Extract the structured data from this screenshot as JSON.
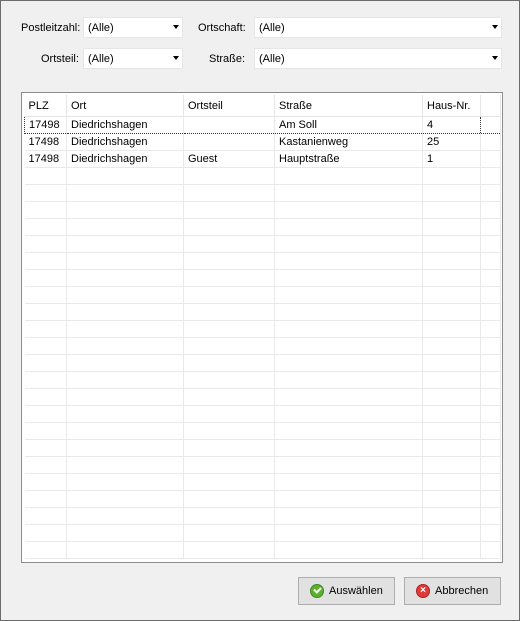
{
  "filters": {
    "plz_label": "Postleitzahl:",
    "plz_value": "(Alle)",
    "ortschaft_label": "Ortschaft:",
    "ortschaft_value": "(Alle)",
    "ortsteil_label": "Ortsteil:",
    "ortsteil_value": "(Alle)",
    "strasse_label": "Straße:",
    "strasse_value": "(Alle)"
  },
  "table": {
    "headers": [
      "PLZ",
      "Ort",
      "Ortsteil",
      "Straße",
      "Haus-Nr."
    ],
    "rows": [
      [
        "17498",
        "Diedrichshagen",
        "",
        "Am Soll",
        "4"
      ],
      [
        "17498",
        "Diedrichshagen",
        "",
        "Kastanienweg",
        "25"
      ],
      [
        "17498",
        "Diedrichshagen",
        "Guest",
        "Hauptstraße",
        "1"
      ]
    ]
  },
  "buttons": {
    "select_label": "Auswählen",
    "cancel_label": "Abbrechen"
  },
  "icons": {
    "select": "check-circle-icon",
    "cancel": "x-circle-icon"
  }
}
